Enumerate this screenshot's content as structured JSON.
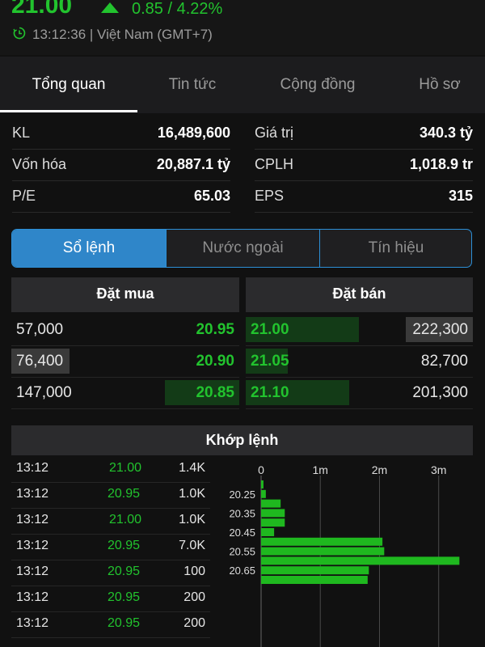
{
  "header": {
    "price": "21.00",
    "change": "0.85 / 4.22%",
    "time": "13:12:36 | Việt Nam (GMT+7)",
    "colors": {
      "up": "#22c32e",
      "accent": "#2f86c9"
    },
    "icons": {
      "trend": "up-triangle-icon",
      "clock": "clock-icon"
    }
  },
  "tabs": [
    {
      "label": "Tổng quan",
      "active": true
    },
    {
      "label": "Tin tức",
      "active": false
    },
    {
      "label": "Cộng đồng",
      "active": false
    },
    {
      "label": "Hồ sơ",
      "active": false
    }
  ],
  "stats": {
    "left": [
      {
        "label": "KL",
        "value": "16,489,600"
      },
      {
        "label": "Vốn hóa",
        "value": "20,887.1 tỷ"
      },
      {
        "label": "P/E",
        "value": "65.03"
      }
    ],
    "right": [
      {
        "label": "Giá trị",
        "value": "340.3 tỷ"
      },
      {
        "label": "CPLH",
        "value": "1,018.9 tr"
      },
      {
        "label": "EPS",
        "value": "315"
      }
    ]
  },
  "segments": [
    {
      "label": "Sổ lệnh",
      "active": true
    },
    {
      "label": "Nước ngoài",
      "active": false
    },
    {
      "label": "Tín hiệu",
      "active": false
    }
  ],
  "orderbook": {
    "buy_title": "Đặt mua",
    "sell_title": "Đặt bán",
    "buy": [
      {
        "volume": "57,000",
        "price": "20.95",
        "level": 0.0
      },
      {
        "volume": "76,400",
        "price": "20.90",
        "level": 0.0
      },
      {
        "volume": "147,000",
        "price": "20.85",
        "level": 0.68
      }
    ],
    "sell": [
      {
        "price": "21.00",
        "volume": "222,300",
        "level": 0.95
      },
      {
        "price": "21.05",
        "volume": "82,700",
        "level": 0.35
      },
      {
        "price": "21.10",
        "volume": "201,300",
        "level": 0.88
      }
    ]
  },
  "matched": {
    "title": "Khớp lệnh",
    "trades": [
      {
        "time": "13:12",
        "price": "21.00",
        "volume": "1.4K"
      },
      {
        "time": "13:12",
        "price": "20.95",
        "volume": "1.0K"
      },
      {
        "time": "13:12",
        "price": "21.00",
        "volume": "1.0K"
      },
      {
        "time": "13:12",
        "price": "20.95",
        "volume": "7.0K"
      },
      {
        "time": "13:12",
        "price": "20.95",
        "volume": "100"
      },
      {
        "time": "13:12",
        "price": "20.95",
        "volume": "200"
      },
      {
        "time": "13:12",
        "price": "20.95",
        "volume": "200"
      }
    ]
  },
  "chart_data": {
    "type": "bar",
    "orientation": "horizontal",
    "x_ticks": [
      "0",
      "1m",
      "2m",
      "3m"
    ],
    "x_tick_values": [
      0,
      1000000,
      2000000,
      3000000
    ],
    "y_tick_labels": [
      "20.25",
      "20.35",
      "20.45",
      "20.55",
      "20.65"
    ],
    "categories": [
      "20.20",
      "20.25",
      "20.30",
      "20.35",
      "20.40",
      "20.45",
      "20.50",
      "20.55",
      "20.60",
      "20.65",
      "20.70"
    ],
    "values": [
      40000,
      80000,
      330000,
      400000,
      400000,
      220000,
      2050000,
      2080000,
      3350000,
      1820000,
      1800000
    ],
    "xlim": [
      0,
      3400000
    ],
    "grid": true,
    "bar_color": "#1fb81f"
  }
}
